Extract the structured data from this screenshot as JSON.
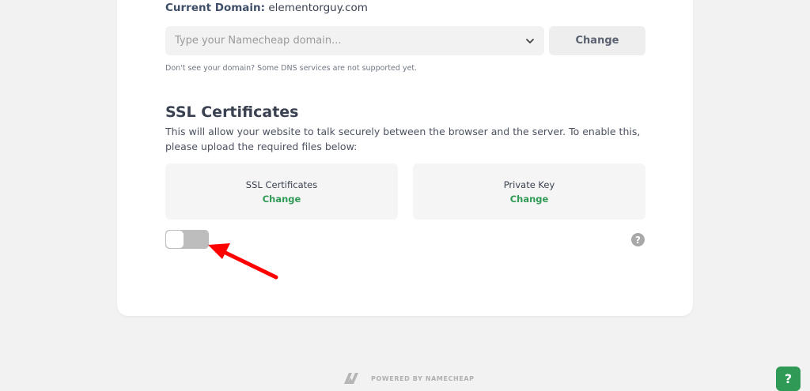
{
  "domain": {
    "current_label": "Current Domain:",
    "current_value": "elementorguy.com",
    "select_placeholder": "Type your Namecheap domain...",
    "change_label": "Change",
    "hint": "Don't see your domain? Some DNS services are not supported yet."
  },
  "ssl": {
    "title": "SSL Certificates",
    "description": "This will allow your website to talk securely between the browser and the server. To enable this, please upload the required files below:",
    "cert_box": {
      "label": "SSL Certificates",
      "action": "Change"
    },
    "key_box": {
      "label": "Private Key",
      "action": "Change"
    },
    "toggle_state": "off",
    "help_icon_text": "?"
  },
  "footer": {
    "powered_by": "POWERED BY NAMECHEAP",
    "logo_icon": "namecheap-logo-icon"
  },
  "help_fab": {
    "text": "?"
  },
  "colors": {
    "accent_green": "#2f9a55",
    "annotation_arrow": "#ff0000",
    "background": "#f2f2f2"
  }
}
